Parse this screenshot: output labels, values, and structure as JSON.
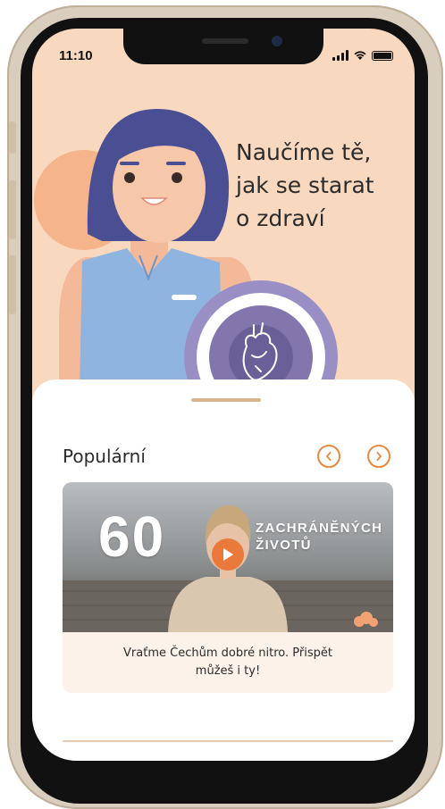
{
  "status_bar": {
    "time": "11:10"
  },
  "hero": {
    "title_lines": [
      "Naučíme tě,",
      "jak se starat",
      "o zdraví"
    ]
  },
  "popular": {
    "title": "Populární",
    "prev_icon": "chevron-left-icon",
    "next_icon": "chevron-right-icon",
    "card": {
      "big_number": "60",
      "overlay_lines": [
        "ZACHRÁNĚNÝCH",
        "ŽIVOTŮ"
      ],
      "play_icon": "play-icon",
      "caption_lines": [
        "Vraťme Čechům dobré nitro. Přispět",
        "můžeš i ty!"
      ]
    }
  },
  "colors": {
    "hero_bg": "#f9d8c0",
    "accent": "#ea7a3b",
    "heart_circle": "#7e72a8",
    "card_bg": "#fdf2ea"
  }
}
